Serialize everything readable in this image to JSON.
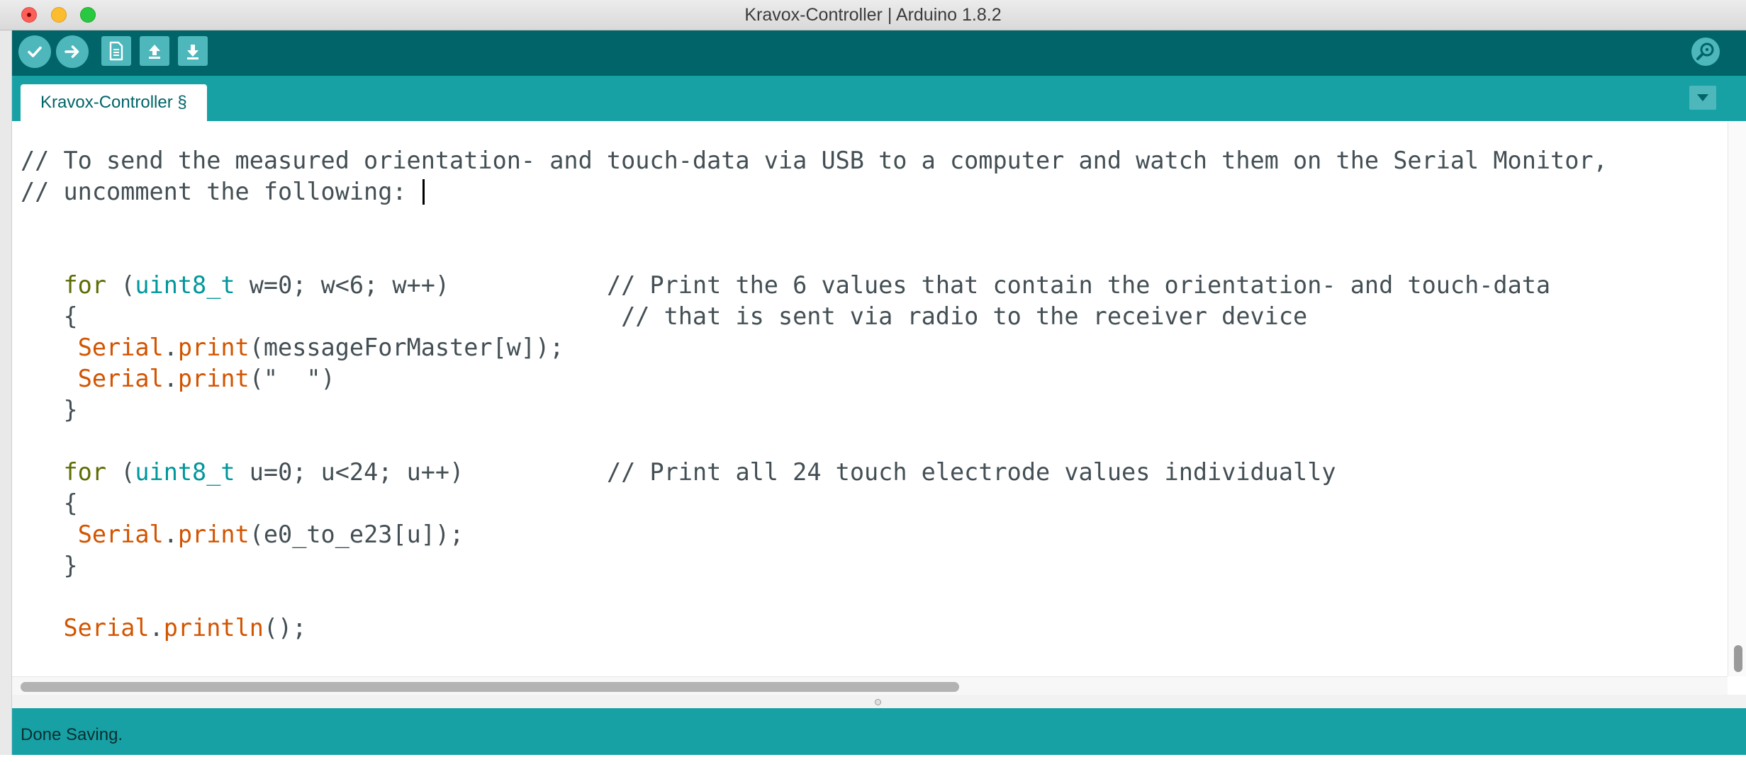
{
  "window": {
    "title": "Kravox-Controller | Arduino 1.8.2"
  },
  "toolbar": {
    "buttons": [
      {
        "name": "verify",
        "icon": "checkmark-icon"
      },
      {
        "name": "upload",
        "icon": "arrow-right-icon"
      },
      {
        "name": "new",
        "icon": "document-icon"
      },
      {
        "name": "open",
        "icon": "arrow-up-icon"
      },
      {
        "name": "save",
        "icon": "arrow-down-icon"
      },
      {
        "name": "serial-monitor",
        "icon": "magnifier-icon"
      }
    ]
  },
  "tabs": [
    {
      "label": "Kravox-Controller §",
      "active": true
    }
  ],
  "tab_menu_icon": "triangle-down-icon",
  "editor": {
    "lines": [
      [
        {
          "t": "// To send the measured orientation- and touch-data via USB to a computer and watch them on the Serial Monitor,",
          "c": "cm"
        }
      ],
      [
        {
          "t": "// uncomment the following: ",
          "c": "cm"
        }
      ],
      [],
      [],
      [
        {
          "t": "   "
        },
        {
          "t": "for",
          "c": "kw"
        },
        {
          "t": " ("
        },
        {
          "t": "uint8_t",
          "c": "ty"
        },
        {
          "t": " w=0; w<6; w++)           "
        },
        {
          "t": "// Print the 6 values that contain the orientation- and touch-data",
          "c": "cm"
        }
      ],
      [
        {
          "t": "   {                                      "
        },
        {
          "t": "// that is sent via radio to the receiver device",
          "c": "cm"
        }
      ],
      [
        {
          "t": "    "
        },
        {
          "t": "Serial",
          "c": "fn"
        },
        {
          "t": "."
        },
        {
          "t": "print",
          "c": "fn"
        },
        {
          "t": "(messageForMaster[w]);"
        }
      ],
      [
        {
          "t": "    "
        },
        {
          "t": "Serial",
          "c": "fn"
        },
        {
          "t": "."
        },
        {
          "t": "print",
          "c": "fn"
        },
        {
          "t": "(\"  \")"
        }
      ],
      [
        {
          "t": "   }"
        }
      ],
      [],
      [
        {
          "t": "   "
        },
        {
          "t": "for",
          "c": "kw"
        },
        {
          "t": " ("
        },
        {
          "t": "uint8_t",
          "c": "ty"
        },
        {
          "t": " u=0; u<24; u++)          "
        },
        {
          "t": "// Print all 24 touch electrode values individually",
          "c": "cm"
        }
      ],
      [
        {
          "t": "   {"
        }
      ],
      [
        {
          "t": "    "
        },
        {
          "t": "Serial",
          "c": "fn"
        },
        {
          "t": "."
        },
        {
          "t": "print",
          "c": "fn"
        },
        {
          "t": "(e0_to_e23[u]);"
        }
      ],
      [
        {
          "t": "   }"
        }
      ],
      [],
      [
        {
          "t": "   "
        },
        {
          "t": "Serial",
          "c": "fn"
        },
        {
          "t": "."
        },
        {
          "t": "println",
          "c": "fn"
        },
        {
          "t": "();"
        }
      ]
    ],
    "cursor_line": 1,
    "colors": {
      "keyword": "#5e6d03",
      "type": "#00979c",
      "function": "#d35400",
      "text": "#434f54"
    }
  },
  "status": {
    "text": "Done Saving."
  },
  "theme": {
    "toolbar_bg": "#006468",
    "tabbar_bg": "#17a1a5",
    "button_bg": "#4db7bb"
  }
}
